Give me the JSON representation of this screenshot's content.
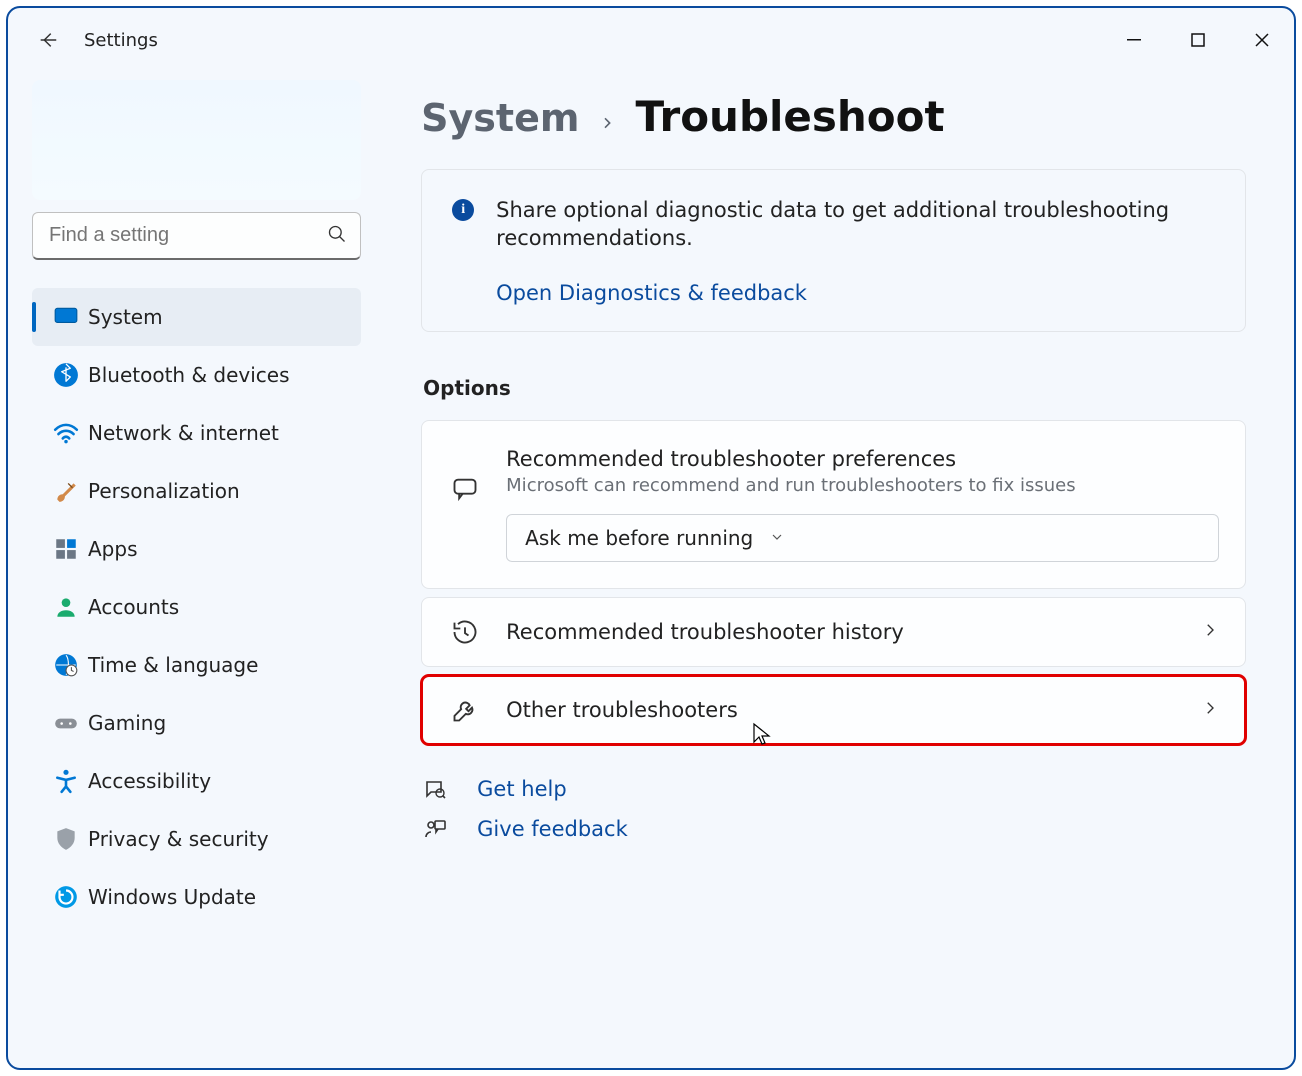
{
  "app_title": "Settings",
  "search": {
    "placeholder": "Find a setting"
  },
  "sidebar": {
    "items": [
      {
        "label": "System"
      },
      {
        "label": "Bluetooth & devices"
      },
      {
        "label": "Network & internet"
      },
      {
        "label": "Personalization"
      },
      {
        "label": "Apps"
      },
      {
        "label": "Accounts"
      },
      {
        "label": "Time & language"
      },
      {
        "label": "Gaming"
      },
      {
        "label": "Accessibility"
      },
      {
        "label": "Privacy & security"
      },
      {
        "label": "Windows Update"
      }
    ]
  },
  "breadcrumb": {
    "parent": "System",
    "current": "Troubleshoot"
  },
  "info": {
    "text": "Share optional diagnostic data to get additional troubleshooting recommendations.",
    "link": "Open Diagnostics & feedback"
  },
  "section": {
    "options_title": "Options"
  },
  "cards": {
    "recommended": {
      "title": "Recommended troubleshooter preferences",
      "subtitle": "Microsoft can recommend and run troubleshooters to fix issues",
      "dropdown_value": "Ask me before running"
    },
    "history": {
      "title": "Recommended troubleshooter history"
    },
    "other": {
      "title": "Other troubleshooters"
    }
  },
  "help": {
    "get_help": "Get help",
    "feedback": "Give feedback"
  },
  "colors": {
    "accent": "#0067c0",
    "link": "#0a4b9e",
    "highlight": "#e00000"
  }
}
